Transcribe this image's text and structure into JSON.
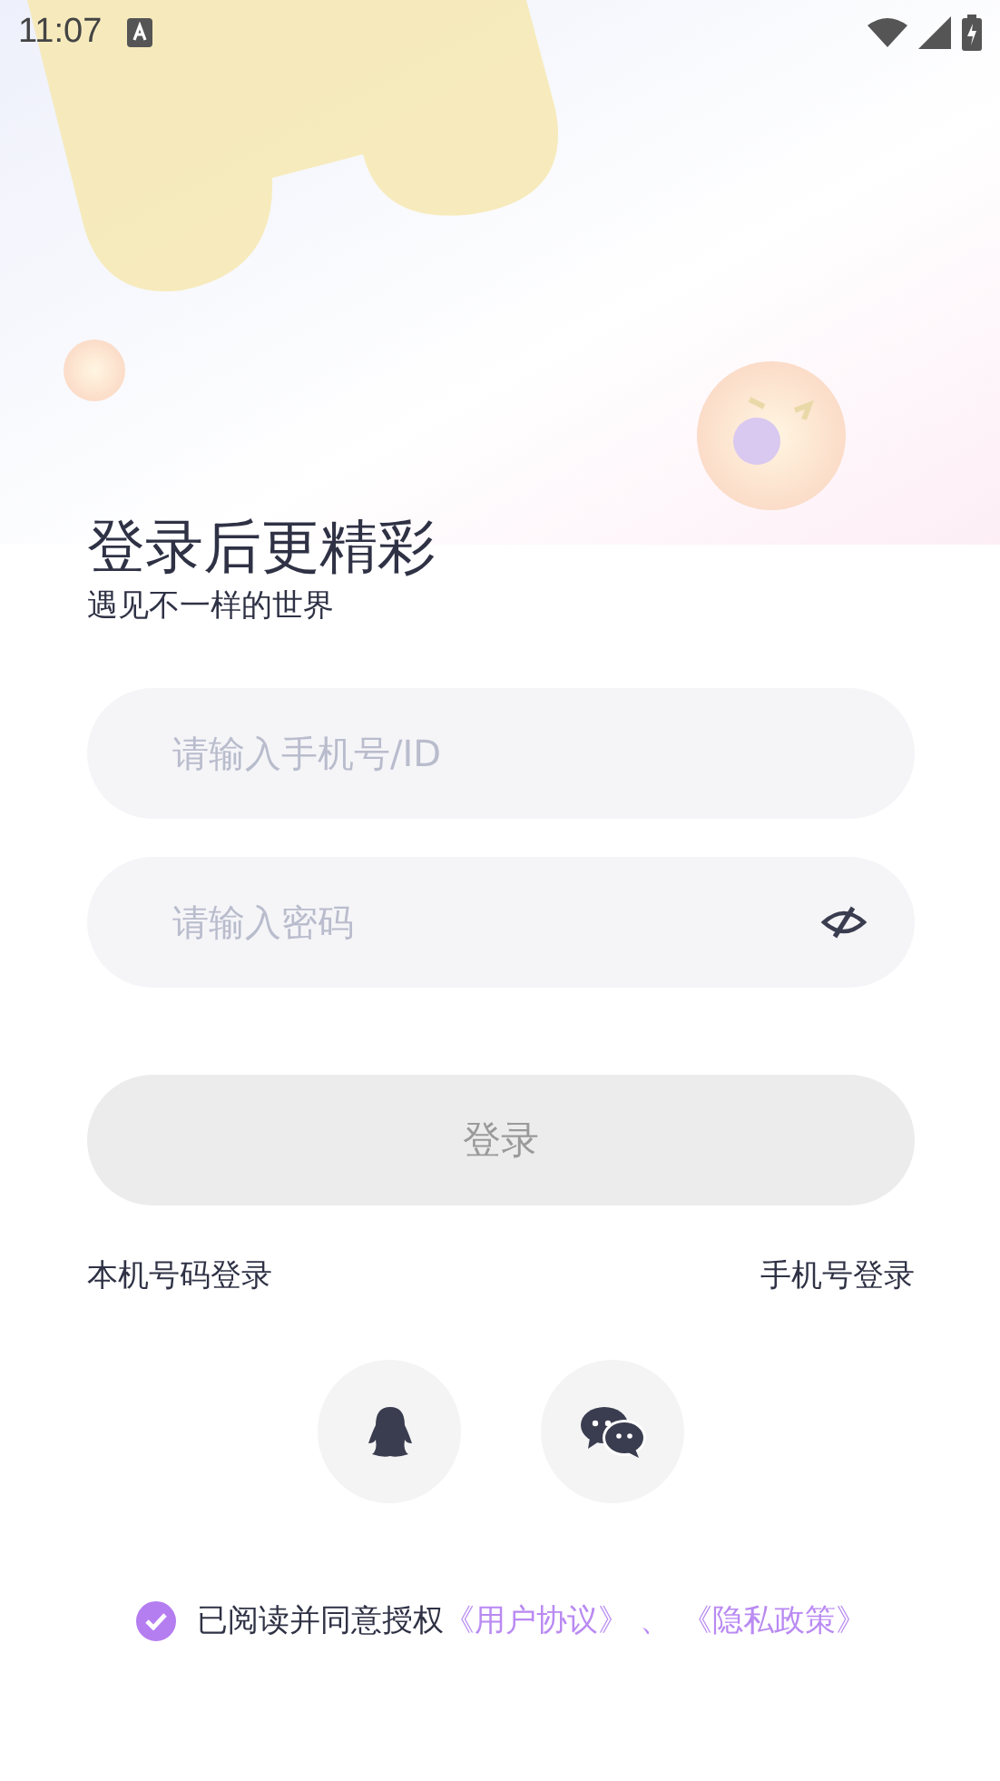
{
  "status_bar": {
    "time": "11:07"
  },
  "heading": {
    "title": "登录后更精彩",
    "subtitle": "遇见不一样的世界"
  },
  "phone_field": {
    "placeholder": "请输入手机号/ID"
  },
  "password_field": {
    "placeholder": "请输入密码",
    "visible": false
  },
  "login_button": {
    "label": "登录",
    "disabled": true
  },
  "alt_logins": [
    "本机号码登录",
    "手机号登录"
  ],
  "social_logins": [
    {
      "kind": "qq"
    },
    {
      "kind": "wechat"
    }
  ],
  "agreement": {
    "checked": true,
    "text": "已阅读并同意授权",
    "links": [
      "《用户协议》",
      "《隐私政策》"
    ],
    "separator": "、"
  }
}
